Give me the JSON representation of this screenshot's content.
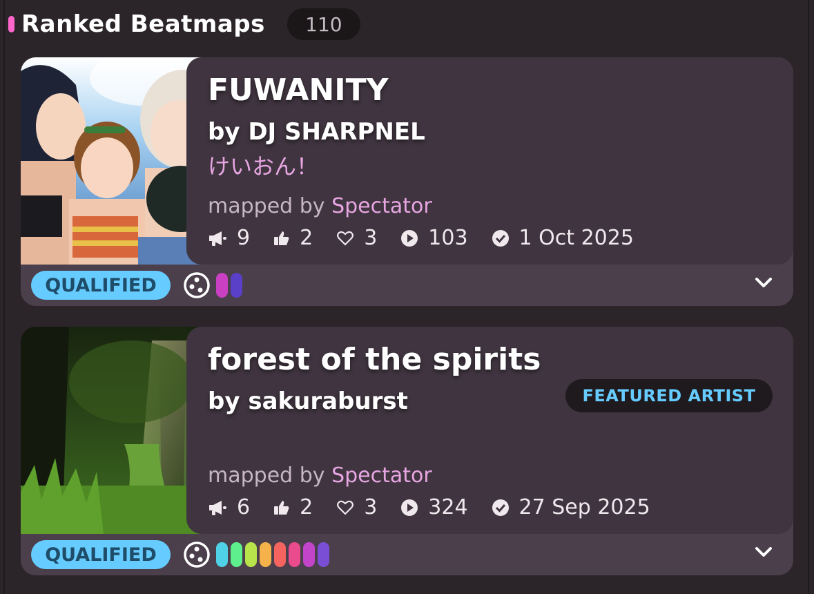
{
  "header": {
    "title": "Ranked Beatmaps",
    "count": "110",
    "accent_color": "#ff66cc"
  },
  "beatmaps": [
    {
      "title": "FUWANITY",
      "artist": "by DJ SHARPNEL",
      "source": "けいおん！",
      "mapped_by_label": "mapped by",
      "mapper": "Spectator",
      "stats": {
        "nominations": "9",
        "upvotes": "2",
        "favourites": "3",
        "plays": "103",
        "date": "1 Oct 2025"
      },
      "status": "QUALIFIED",
      "mode_icon": "osu-mode-icon",
      "difficulty_colors": [
        "#c940c3",
        "#5a3fc9"
      ]
    },
    {
      "title": "forest of the spirits",
      "artist": "by sakuraburst",
      "badge": "FEATURED ARTIST",
      "mapped_by_label": "mapped by",
      "mapper": "Spectator",
      "stats": {
        "nominations": "6",
        "upvotes": "2",
        "favourites": "3",
        "plays": "324",
        "date": "27 Sep 2025"
      },
      "status": "QUALIFIED",
      "mode_icon": "osu-mode-icon",
      "difficulty_colors": [
        "#4fd2e8",
        "#5ef08c",
        "#b8e34a",
        "#f6b24a",
        "#f5645f",
        "#ea4b8d",
        "#c244c8",
        "#7a4fd6"
      ]
    }
  ],
  "colors": {
    "qualified_pill": "#66ccff",
    "featured_artist_text": "#66ccff",
    "mapper": "#e7a6e2"
  }
}
